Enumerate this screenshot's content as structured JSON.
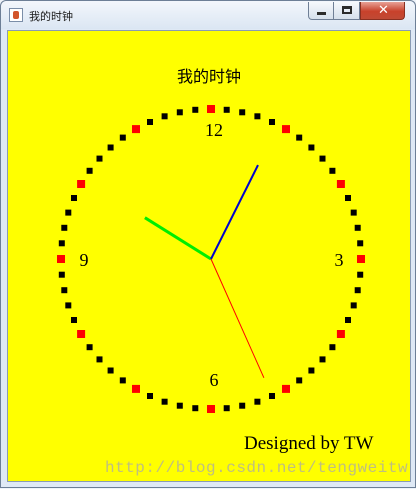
{
  "window": {
    "title": "我的时钟",
    "controls": {
      "minimize": "minimize",
      "maximize": "maximize",
      "close": "close"
    }
  },
  "clock": {
    "heading": "我的时钟",
    "numerals": {
      "twelve": "12",
      "three": "3",
      "six": "6",
      "nine": "9"
    },
    "time": {
      "hour": 10,
      "minute": 4,
      "second": 26
    },
    "colors": {
      "background": "#ffff00",
      "hour_hand": "#00ee00",
      "minute_hand": "#0000cc",
      "second_hand": "#ff0000",
      "five_minute_mark": "#ff0000",
      "minute_mark": "#000000"
    },
    "signature": "Designed by TW"
  },
  "watermark": "http://blog.csdn.net/tengweitw"
}
